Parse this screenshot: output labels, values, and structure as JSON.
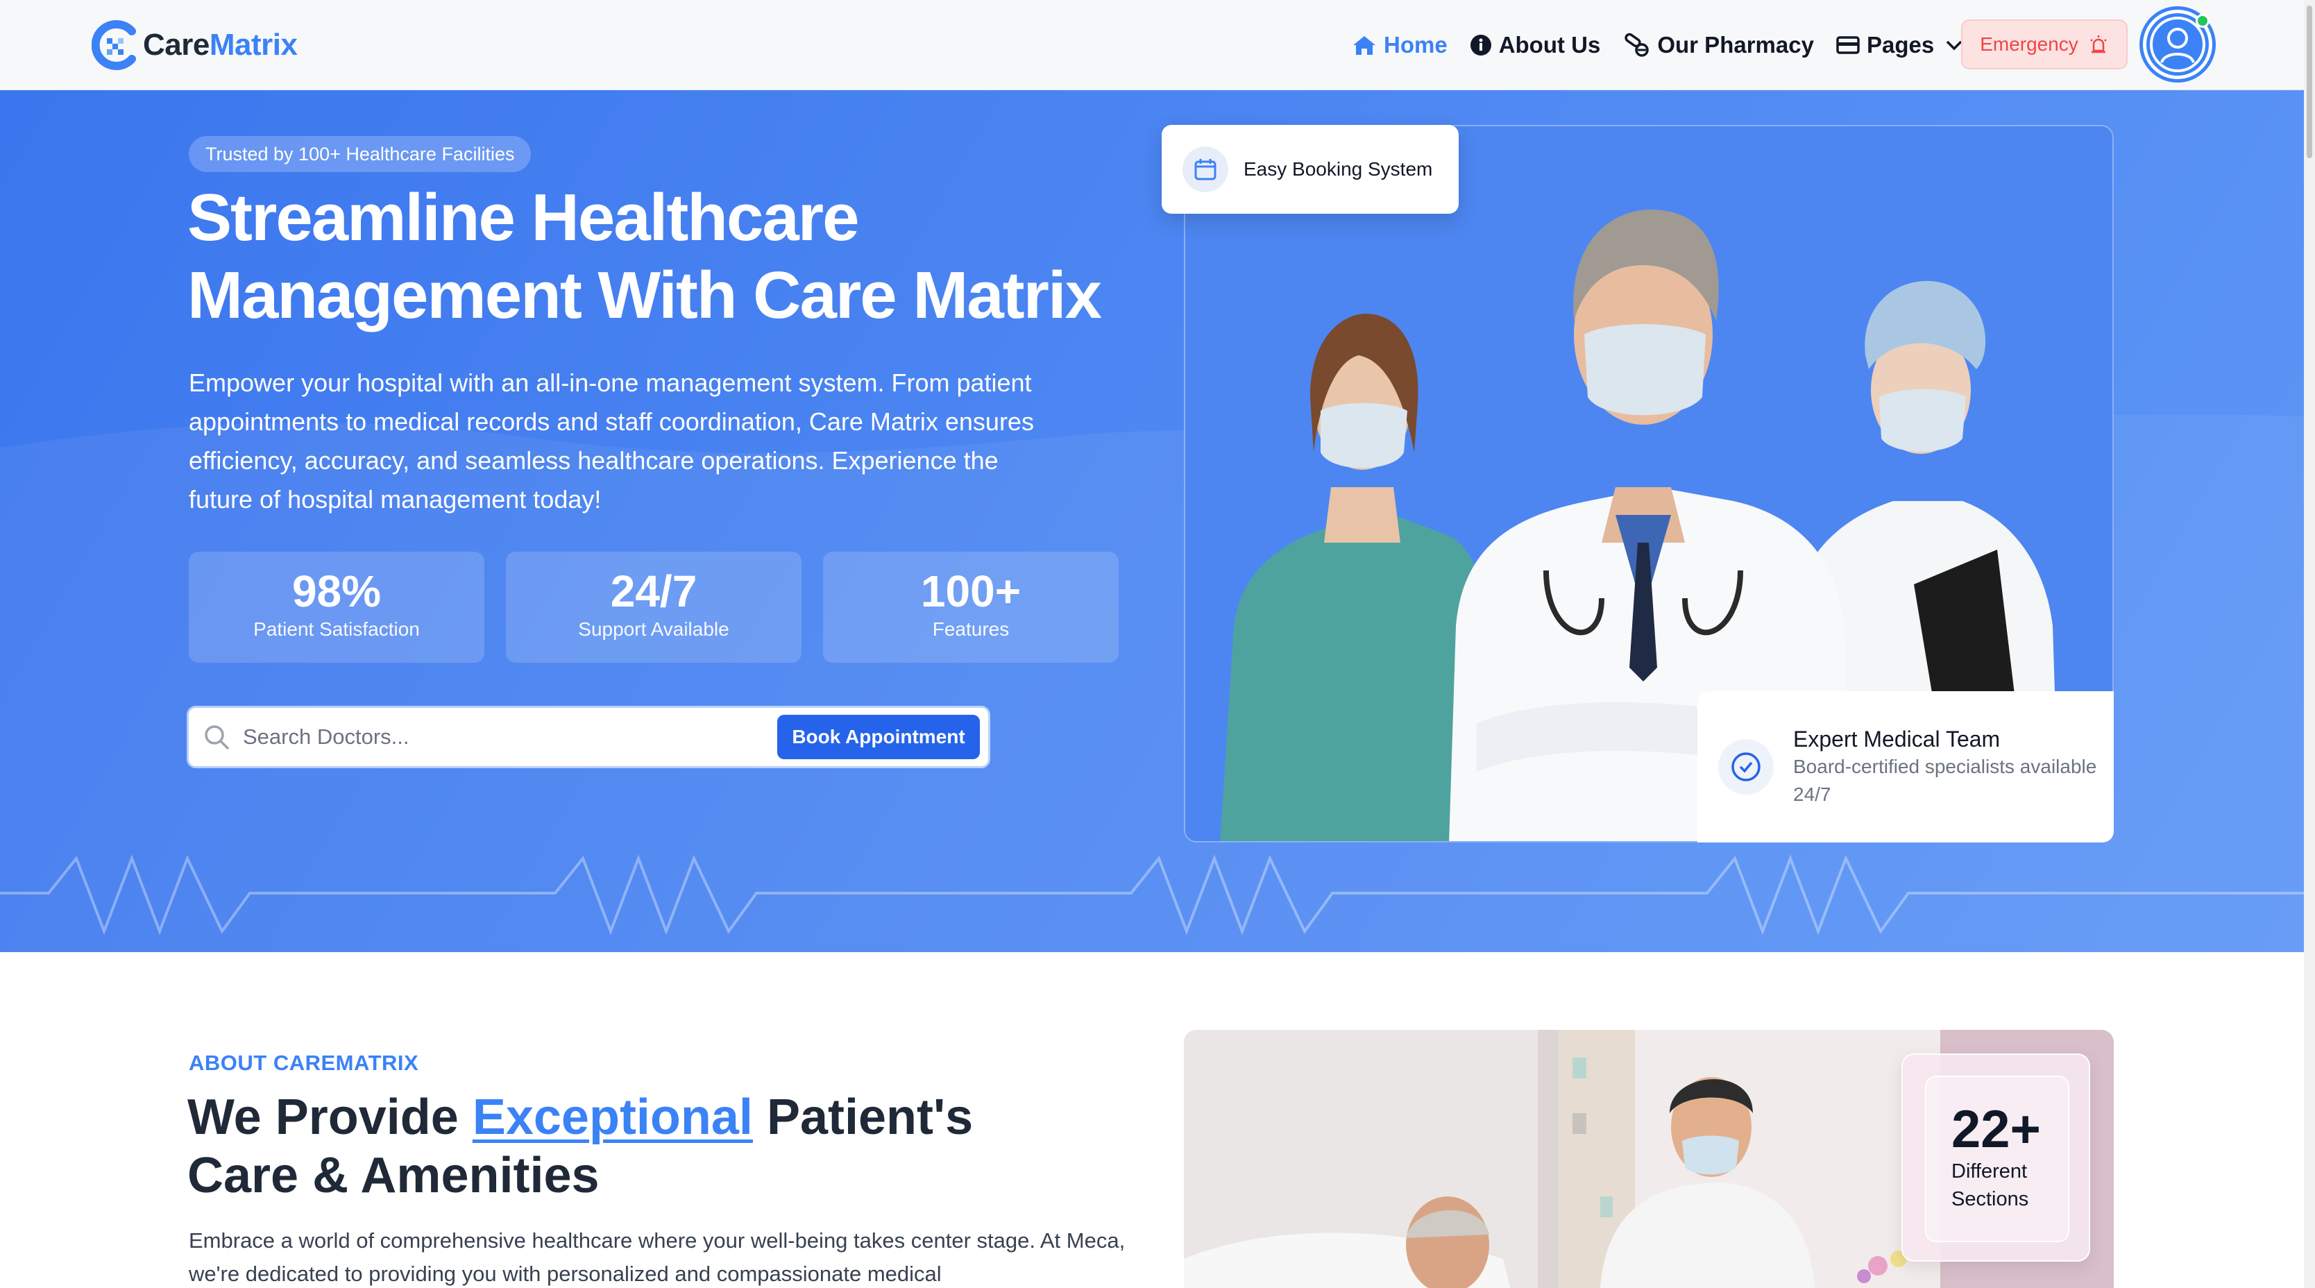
{
  "brand": {
    "name_part1": "Care",
    "name_part2": "Matrix",
    "accent_color": "#3b82f6"
  },
  "nav": {
    "items": [
      {
        "label": "Home",
        "icon": "home-icon",
        "active": true
      },
      {
        "label": "About Us",
        "icon": "info-icon",
        "active": false
      },
      {
        "label": "Our Pharmacy",
        "icon": "pills-icon",
        "active": false
      },
      {
        "label": "Pages",
        "icon": "card-icon",
        "active": false,
        "has_dropdown": true
      }
    ],
    "emergency_label": "Emergency",
    "emergency_icon": "siren-icon",
    "avatar_icon": "user-avatar-icon",
    "online_status_color": "#22c55e"
  },
  "hero": {
    "badge": "Trusted by 100+ Healthcare Facilities",
    "title_line1": "Streamline Healthcare",
    "title_line2": "Management With Care Matrix",
    "description": "Empower your hospital with an all-in-one management system. From patient appointments to medical records and staff coordination, Care Matrix ensures efficiency, accuracy, and seamless healthcare operations. Experience the future of hospital management today!",
    "stats": [
      {
        "value": "98%",
        "label": "Patient Satisfaction"
      },
      {
        "value": "24/7",
        "label": "Support Available"
      },
      {
        "value": "100+",
        "label": "Features"
      }
    ],
    "search": {
      "placeholder": "Search Doctors...",
      "value": "",
      "button_label": "Book Appointment"
    },
    "booking_chip": "Easy Booking System",
    "expert_card": {
      "title": "Expert Medical Team",
      "subtitle": "Board-certified specialists available 24/7"
    },
    "background_color": "#4c86f2"
  },
  "about": {
    "eyebrow": "ABOUT CAREMATRIX",
    "title_pre": "We Provide ",
    "title_highlight": "Exceptional",
    "title_post": " Patient's",
    "title_line2": "Care & Amenities",
    "description": "Embrace a world of comprehensive healthcare where your well-being takes center stage. At Meca, we're dedicated to providing you with personalized and compassionate medical",
    "sections_badge": {
      "value": "22+",
      "label_line1": "Different",
      "label_line2": "Sections"
    }
  }
}
